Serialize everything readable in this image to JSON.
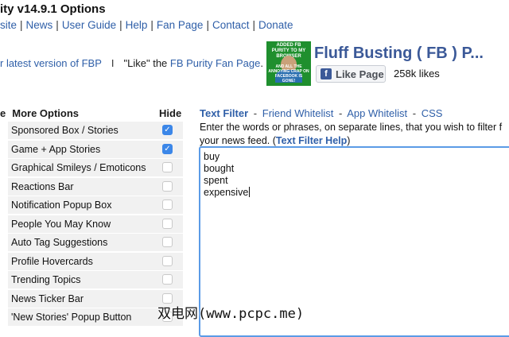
{
  "header": {
    "title": "ity v14.9.1 Options",
    "nav": [
      "site",
      "News",
      "User Guide",
      "Help",
      "Fan Page",
      "Contact",
      "Donate"
    ],
    "nav_separator": "|"
  },
  "promo": {
    "latest_link": "r latest version of FBP",
    "pipe": "I",
    "like_prefix": "\"Like\" the ",
    "fan_page_link": "FB Purity Fan Page",
    "like_suffix": "."
  },
  "fan_box": {
    "image_top_text": "ADDED FB PURITY TO MY BROWSER",
    "image_bottom_text": "AND ALL THE ANNOYING CRAP ON FACEBOOK IS GONE!",
    "page_name": "Fluff Busting ( FB ) P...",
    "like_button_label": "Like Page",
    "fb_logo": "f",
    "like_count": "258k likes"
  },
  "more_options": {
    "heading_prefix": "e",
    "heading": "More Options",
    "hide_heading": "Hide",
    "rows": [
      {
        "label": "Sponsored Box / Stories",
        "checked": true
      },
      {
        "label": "Game + App Stories",
        "checked": true
      },
      {
        "label": "Graphical Smileys / Emoticons",
        "checked": false
      },
      {
        "label": "Reactions Bar",
        "checked": false
      },
      {
        "label": "Notification Popup Box",
        "checked": false
      },
      {
        "label": "People You May Know",
        "checked": false
      },
      {
        "label": "Auto Tag Suggestions",
        "checked": false
      },
      {
        "label": "Profile Hovercards",
        "checked": false
      },
      {
        "label": "Trending Topics",
        "checked": false
      },
      {
        "label": "News Ticker Bar",
        "checked": false
      },
      {
        "label": "'New Stories' Popup Button",
        "checked": false
      }
    ],
    "check_glyph": "✓"
  },
  "filter": {
    "tabs": [
      "Text Filter",
      "Friend Whitelist",
      "App Whitelist",
      "CSS"
    ],
    "tab_separator": "-",
    "instructions_line1": "Enter the words or phrases, on separate lines, that you wish to filter f",
    "instructions_line2": "your news feed. (",
    "help_link": "Text Filter Help",
    "instructions_close": ")",
    "lines": [
      "buy",
      "bought",
      "spent",
      "expensive"
    ]
  },
  "watermark": "双电网(www.pcpc.me)",
  "colors": {
    "link": "#2f5fa8",
    "fb_blue": "#3b5998",
    "checkbox_on": "#3c87e8",
    "row_bg": "#f1f1f1",
    "textarea_focus": "#5b9be6"
  }
}
